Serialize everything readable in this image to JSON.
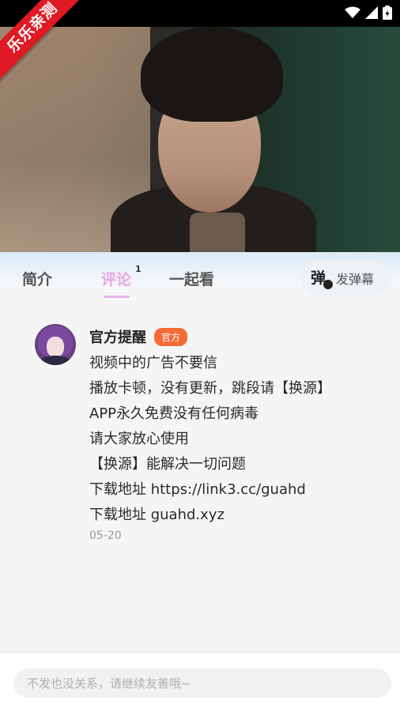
{
  "status_bar": {
    "icons": [
      "wifi-icon",
      "signal-icon",
      "battery-icon"
    ]
  },
  "ribbon": {
    "text": "乐乐亲测"
  },
  "tabs": {
    "intro": "简介",
    "comments": "评论",
    "comments_count": "1",
    "watch_together": "一起看",
    "active": "comments"
  },
  "danmaku": {
    "label": "发弹幕",
    "icon_glyph": "弹"
  },
  "comment": {
    "author": "官方提醒",
    "badge": "官方",
    "lines": [
      "视频中的广告不要信",
      "播放卡顿，没有更新，跳段请【换源】",
      "APP永久免费没有任何病毒",
      "请大家放心使用",
      "【换源】能解决一切问题",
      "下载地址  https://link3.cc/guahd",
      "下载地址  guahd.xyz"
    ],
    "date": "05-20"
  },
  "input": {
    "placeholder": "不发也没关系，请继续友善哦~"
  },
  "colors": {
    "accent_tab": "#e8a6e4",
    "badge": "#f36b35",
    "ribbon": "#e01a24"
  }
}
